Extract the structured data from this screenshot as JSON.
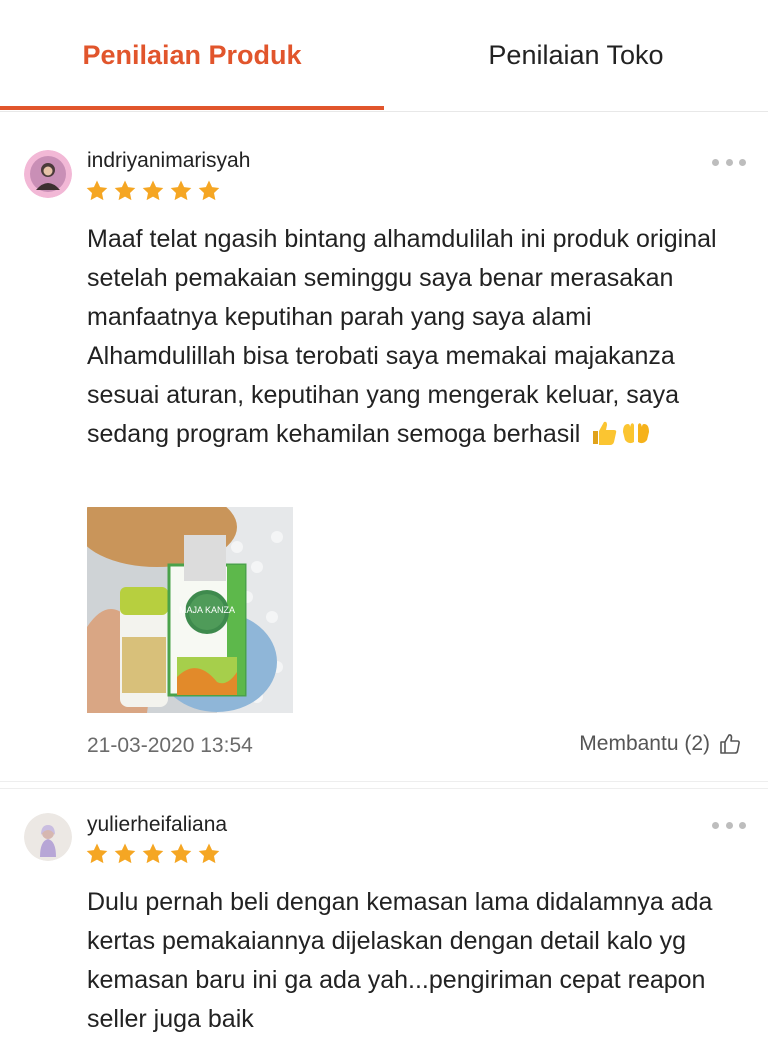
{
  "tabs": {
    "product_reviews": "Penilaian Produk",
    "store_reviews": "Penilaian Toko"
  },
  "colors": {
    "accent": "#e1552c",
    "star": "#f5a623",
    "muted_text": "#6b6b6b"
  },
  "reviews": [
    {
      "username": "indriyanimarisyah",
      "rating": 5,
      "text": "Maaf telat ngasih bintang alhamdulilah ini produk original setelah pemakaian seminggu saya benar merasakan manfaatnya keputihan parah yang saya alami Alhamdulillah bisa terobati saya memakai majakanza sesuai aturan, keputihan yang mengerak keluar, saya sedang program kehamilan semoga berhasil",
      "emojis": [
        "thumbs-up-icon",
        "open-hands-icon"
      ],
      "photo_text": "MAJA KANZA",
      "date": "21-03-2020 13:54",
      "helpful_label": "Membantu (2)"
    },
    {
      "username": "yulierheifaliana",
      "rating": 5,
      "text": "Dulu pernah beli dengan kemasan lama didalamnya ada kertas pemakaiannya dijelaskan dengan detail kalo yg kemasan baru ini ga ada yah...pengiriman cepat reapon seller juga baik"
    }
  ]
}
